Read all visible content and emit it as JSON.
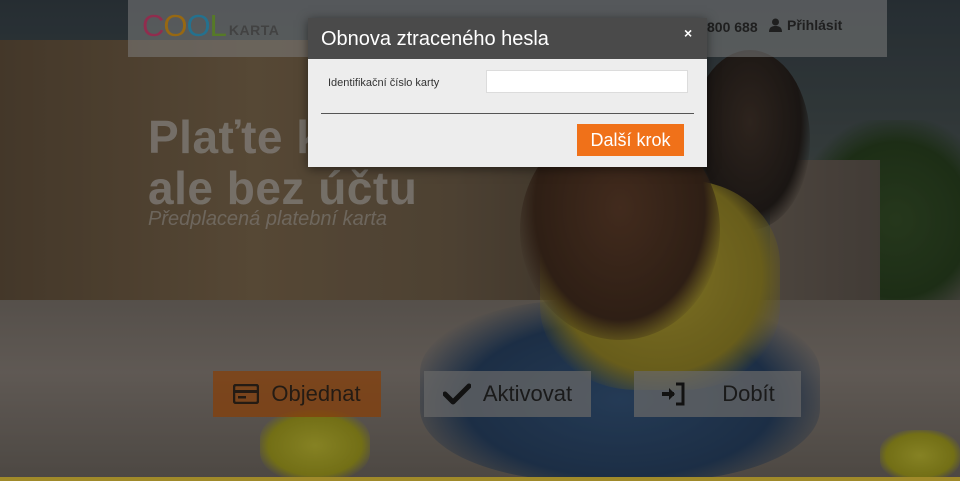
{
  "header": {
    "logo_cool_letters": [
      "C",
      "O",
      "O",
      "L"
    ],
    "logo_cool_colors": [
      "#e84a7f",
      "#f4a81d",
      "#3ab7e6",
      "#8cc63f"
    ],
    "logo_karta": "KARTA",
    "phone": "800 688",
    "login_label": "Přihlásit",
    "login_icon": "user-icon"
  },
  "hero": {
    "line1": "Plaťte k",
    "line2": "ale bez účtu",
    "subtitle": "Předplacená platební karta"
  },
  "actions": [
    {
      "label": "Objednat",
      "icon": "card-icon",
      "color": "#d46817"
    },
    {
      "label": "Aktivovat",
      "icon": "checkmark-icon"
    },
    {
      "label": "Dobít",
      "icon": "sign-in-icon"
    }
  ],
  "modal": {
    "title": "Obnova ztraceného hesla",
    "close_label": "×",
    "field_label": "Identifikační číslo karty",
    "field_value": "",
    "field_placeholder": "",
    "submit_label": "Další krok",
    "accent_color": "#f07119"
  }
}
